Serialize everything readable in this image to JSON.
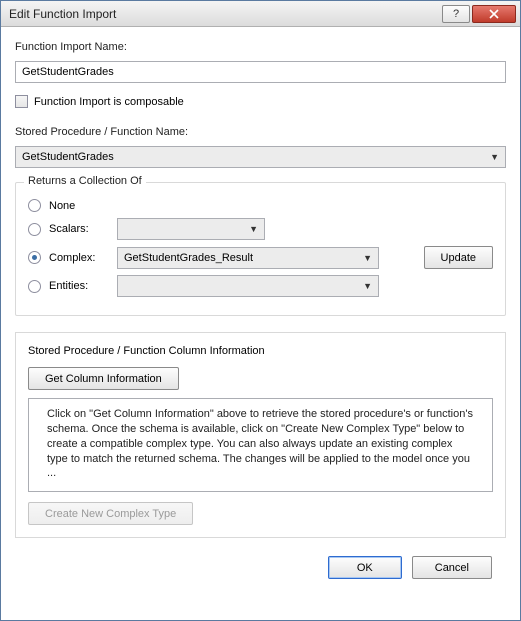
{
  "titlebar": {
    "title": "Edit Function Import"
  },
  "labels": {
    "function_import_name": "Function Import Name:",
    "composable": "Function Import is composable",
    "stored_proc_name": "Stored Procedure / Function Name:",
    "col_info_title": "Stored Procedure / Function Column Information"
  },
  "values": {
    "function_import_name": "GetStudentGrades",
    "stored_proc_selected": "GetStudentGrades",
    "complex_selected": "GetStudentGrades_Result",
    "scalars_selected": "",
    "entities_selected": ""
  },
  "returns": {
    "group_title": "Returns a Collection Of",
    "none": "None",
    "scalars": "Scalars:",
    "complex": "Complex:",
    "entities": "Entities:",
    "update": "Update"
  },
  "colinfo": {
    "get_btn": "Get Column Information",
    "info_text": "Click on \"Get Column Information\" above to retrieve the stored procedure's or function's schema. Once the schema is available, click on \"Create New Complex Type\" below to create a compatible complex type. You can also always update an existing complex type to match the returned schema. The changes will be applied to the model once you ...",
    "create_btn": "Create New Complex Type"
  },
  "footer": {
    "ok": "OK",
    "cancel": "Cancel"
  }
}
